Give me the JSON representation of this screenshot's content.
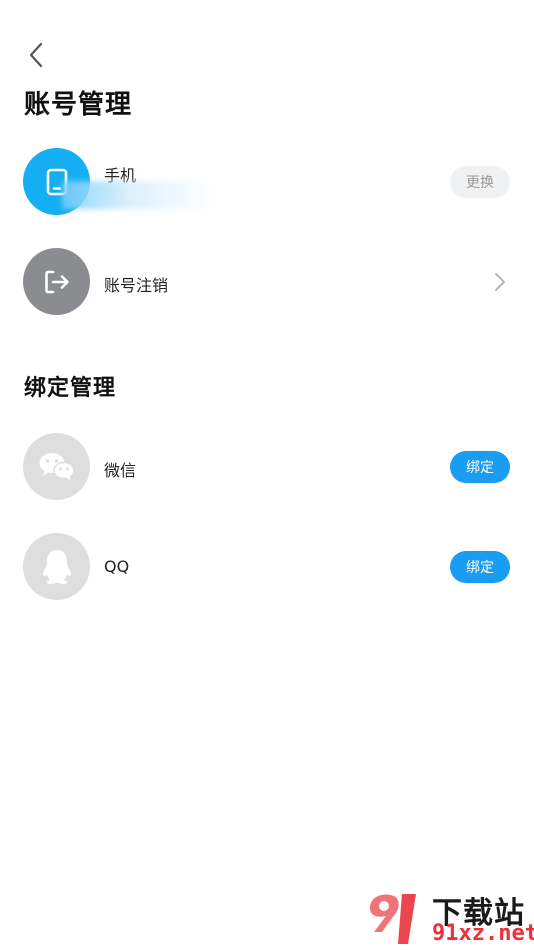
{
  "header": {
    "title": "账号管理"
  },
  "account": {
    "phone": {
      "label": "手机",
      "action": "更换"
    },
    "cancel": {
      "label": "账号注销"
    }
  },
  "binding": {
    "title": "绑定管理",
    "items": [
      {
        "label": "微信",
        "action": "绑定"
      },
      {
        "label": "QQ",
        "action": "绑定"
      }
    ]
  },
  "watermark": {
    "line1": "下载站",
    "line2": "91xz.net"
  },
  "colors": {
    "accent": "#1a9cf0",
    "phone_avatar": "#16aef2",
    "cancel_avatar": "#8a8c8f",
    "bind_avatar": "#dedede"
  }
}
